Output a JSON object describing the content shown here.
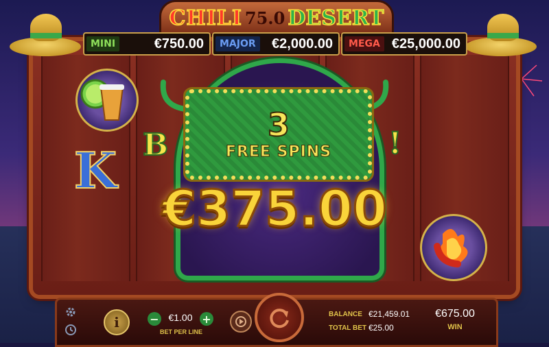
{
  "game": {
    "title_left": "CHILI",
    "title_mid": "75.0",
    "title_right": "DESERT"
  },
  "jackpots": [
    {
      "label": "MINI",
      "value": "€750.00",
      "label_color": "#7ad34a"
    },
    {
      "label": "MAJOR",
      "value": "€2,000.00",
      "label_color": "#4a7ad8"
    },
    {
      "label": "MEGA",
      "value": "€25,000.00",
      "label_color": "#e23a2a"
    }
  ],
  "reels": {
    "k_symbol": "K",
    "bonus_partial_left": "B",
    "bonus_partial_right": "!"
  },
  "free_spins": {
    "count": "3",
    "label": "FREE SPINS",
    "win_amount": "€375.00"
  },
  "controls": {
    "bet_value": "€1.00",
    "bet_label": "BET PER LINE",
    "minus": "−",
    "plus": "+",
    "info": "i",
    "balance_label": "BALANCE",
    "balance_value": "€21,459.01",
    "total_bet_label": "TOTAL BET",
    "total_bet_value": "€25.00",
    "win_value": "€675.00",
    "win_label": "WIN"
  },
  "colors": {
    "accent_gold": "#f9d43a",
    "frame_green": "#2fa84a"
  }
}
